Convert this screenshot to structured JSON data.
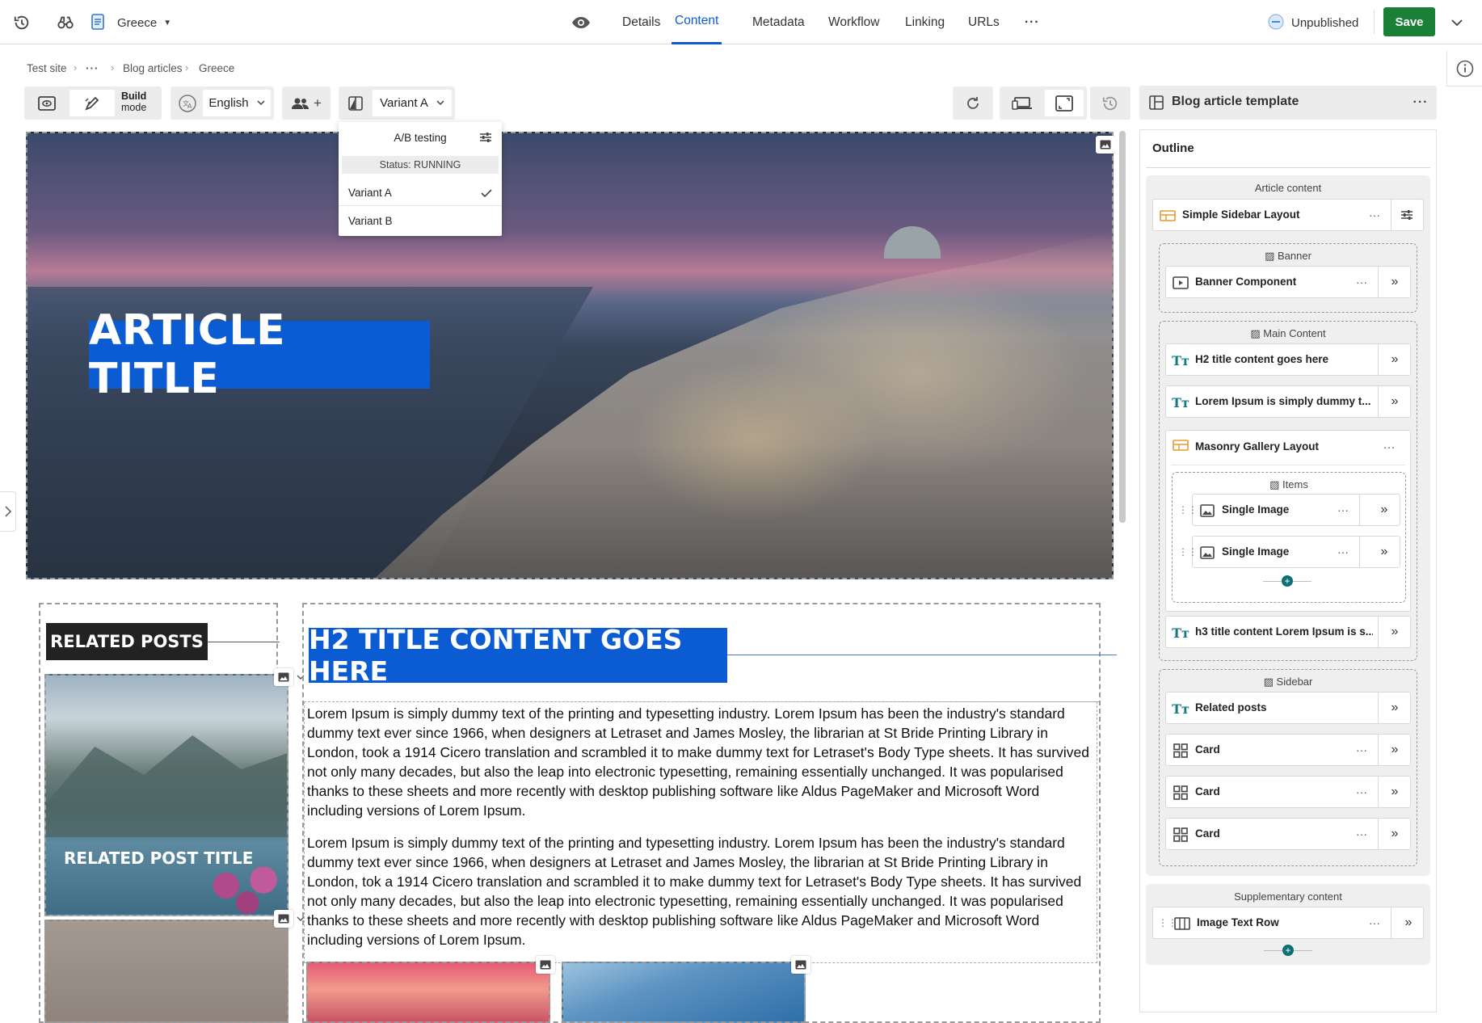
{
  "topbar": {
    "site_dropdown": "Greece",
    "tabs": [
      {
        "label": "Details"
      },
      {
        "label": "Content"
      },
      {
        "label": "Metadata"
      },
      {
        "label": "Workflow"
      },
      {
        "label": "Linking"
      },
      {
        "label": "URLs"
      }
    ],
    "active_tab": "Content",
    "more_label": "···",
    "status": "Unpublished",
    "save_label": "Save"
  },
  "breadcrumb": [
    "Test site",
    "···",
    "Blog articles",
    "Greece"
  ],
  "toolbar": {
    "build_mode_label": "Build\nmode",
    "build_line1": "Build",
    "build_line2": "mode",
    "language": "English",
    "variant": "Variant A",
    "template_title": "Blog article template"
  },
  "ab_dropdown": {
    "title": "A/B testing",
    "status": "Status: RUNNING",
    "options": [
      {
        "label": "Variant A",
        "selected": true
      },
      {
        "label": "Variant B",
        "selected": false
      }
    ]
  },
  "canvas": {
    "hero_title": "ARTICLE TITLE",
    "related_heading": "RELATED POSTS",
    "related_post_title": "RELATED POST TITLE",
    "h2_title": "H2 TITLE CONTENT GOES HERE",
    "paragraphs": [
      "Lorem Ipsum is simply dummy text of the printing and typesetting industry. Lorem Ipsum has been the industry's standard dummy text ever since 1966, when designers at Letraset and James Mosley, the librarian at St Bride Printing Library in London, took a 1914 Cicero translation and scrambled it to make dummy text for Letraset's Body Type sheets. It has survived not only many decades, but also the leap into electronic typesetting, remaining essentially unchanged. It was popularised thanks to these sheets and more recently with desktop publishing software like Aldus PageMaker and Microsoft Word including versions of Lorem Ipsum.",
      " Lorem Ipsum is simply dummy text of the printing and typesetting industry. Lorem Ipsum has been the industry's standard dummy text ever since 1966, when designers at Letraset and James Mosley, the librarian at St Bride Printing Library in London, tok a 1914 Cicero translation and scrambled it to make dummy text for Letraset's Body Type sheets. It has survived not only many decades, but also the leap into electronic typesetting, remaining essentially unchanged. It was popularised thanks to these sheets and more recently with desktop publishing software like Aldus PageMaker and Microsoft Word including versions of Lorem Ipsum."
    ]
  },
  "outline": {
    "title": "Outline",
    "article_content_label": "Article content",
    "layout_row": "Simple Sidebar Layout",
    "banner_zone": "Banner",
    "banner_row": "Banner Component",
    "main_zone": "Main Content",
    "main_rows": [
      "H2 title content goes here",
      "Lorem Ipsum is simply dummy t..."
    ],
    "gallery_row": "Masonry Gallery Layout",
    "items_zone": "Items",
    "item_rows": [
      "Single Image",
      "Single Image"
    ],
    "h3_row": "h3 title content Lorem Ipsum is s...",
    "sidebar_zone": "Sidebar",
    "sidebar_rows": [
      "Related posts",
      "Card",
      "Card",
      "Card"
    ],
    "supplementary_label": "Supplementary content",
    "supplementary_row": "Image Text Row"
  },
  "colors": {
    "accent": "#0b5bd3",
    "save": "#1a7f37",
    "add_dot": "#0f6f74"
  }
}
